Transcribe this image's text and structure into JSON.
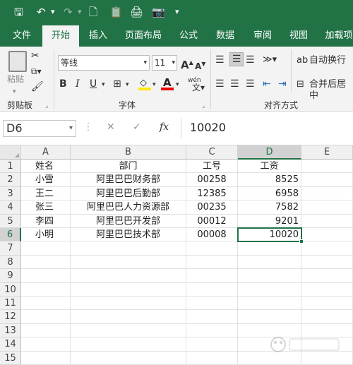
{
  "qat": {
    "save": "🖫",
    "undo": "↶",
    "redo": "↷",
    "preview": "🗋",
    "paste": "📋",
    "camera": "📷",
    "more": "▾",
    "print": "🖨"
  },
  "tabs": [
    "文件",
    "开始",
    "插入",
    "页面布局",
    "公式",
    "数据",
    "审阅",
    "视图",
    "加载项"
  ],
  "ribbon": {
    "paste_label": "粘贴",
    "clipboard_label": "剪贴板",
    "font_name": "等线",
    "font_size": "11",
    "font_label": "字体",
    "bold": "B",
    "italic": "I",
    "underline": "U",
    "wen": "wén",
    "wrap_text": "自动换行",
    "merge_center": "合并后居中",
    "align_label": "对齐方式",
    "grow_font": "A",
    "shrink_font": "A"
  },
  "formula_bar": {
    "name_box": "D6",
    "value": "10020",
    "cancel": "✕",
    "enter": "✓",
    "fx": "fx"
  },
  "sheet": {
    "columns": [
      "A",
      "B",
      "C",
      "D",
      "E"
    ],
    "rows": [
      "1",
      "2",
      "3",
      "4",
      "5",
      "6",
      "7",
      "8",
      "9",
      "10",
      "11",
      "12",
      "13",
      "14",
      "15"
    ],
    "cells": [
      [
        "姓名",
        "部门",
        "工号",
        "工资"
      ],
      [
        "小雪",
        "阿里巴巴财务部",
        "00258",
        "8525"
      ],
      [
        "王二",
        "阿里巴巴后勤部",
        "12385",
        "6958"
      ],
      [
        "张三",
        "阿里巴巴人力资源部",
        "00235",
        "7582"
      ],
      [
        "李四",
        "阿里巴巴开发部",
        "00012",
        "9201"
      ],
      [
        "小明",
        "阿里巴巴技术部",
        "00008",
        "10020"
      ]
    ],
    "selected_cell": "D6"
  },
  "colors": {
    "accent": "#217346",
    "ribbon": "#f3f3f3"
  }
}
